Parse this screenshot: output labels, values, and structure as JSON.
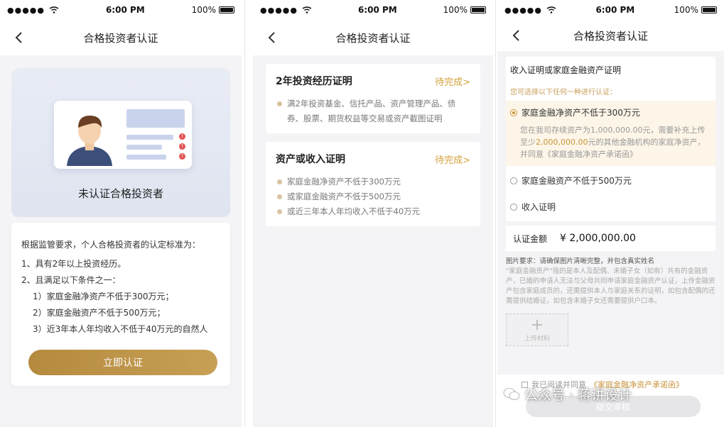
{
  "status_bar": {
    "signal": "●●●●●",
    "time": "6:00 PM",
    "battery": "100%"
  },
  "screen1": {
    "nav_title": "合格投资者认证",
    "hero_title": "未认证合格投资者",
    "rules": [
      "根据监管要求，个人合格投资者的认定标准为：",
      "1、具有2年以上投资经历。",
      "2、且满足以下条件之一：",
      "1）家庭金融净资产不低于300万元；",
      "2）家庭金融资产不低于500万元；",
      "3）近3年本人年均收入不低于40万元的自然人"
    ],
    "button": "立即认证"
  },
  "screen2": {
    "nav_title": "合格投资者认证",
    "cards": [
      {
        "title": "2年投资经历证明",
        "status": "待完成>",
        "items": [
          "满2年投资基金、信托产品、资产管理产品、债券、股票、期货权益等交易或资产截图证明"
        ]
      },
      {
        "title": "资产或收入证明",
        "status": "待完成>",
        "items": [
          "家庭金融净资产不低于300万元",
          "或家庭金融资产不低于500万元",
          "或近三年本人年均收入不低于40万元"
        ]
      }
    ]
  },
  "screen3": {
    "nav_title": "合格投资者认证",
    "section_title": "收入证明或家庭金融资产证明",
    "hint": "您可选择以下任何一种进行认证：",
    "options": [
      {
        "label": "家庭金融净资产不低于300万元",
        "selected": true
      },
      {
        "label": "家庭金融资产不低于500万元",
        "selected": false
      },
      {
        "label": "收入证明",
        "selected": false
      }
    ],
    "option_desc_a": "您在我司存续资产为1,000,000.00元，需要补充上传至少",
    "option_desc_hl": "2,000,000.00",
    "option_desc_b": "元的其他金融机构的家庭净资产，并同意《家庭金融净资产承诺函》",
    "amount_label": "认证金额",
    "amount_value": "¥ 2,000,000.00",
    "note_head": "图片要求：请确保图片清晰完整，并包含真实姓名",
    "note_body": "\"家庭金融资产\"指的是本人及配偶、未婚子女（如有）共有的金融资产，已婚的申请人无法与父母共同申请家庭金融资产认证，上传金融资产包含家庭成员的，还需提供本人与家庭关系的证明，如包含配偶的还需提供结婚证，如包含未婚子女还需要提供户口本。",
    "upload_label": "上传材料",
    "agree_text": "我已阅读并同意",
    "agree_link": "《家庭金融净资产承诺函》",
    "submit": "提交审核"
  },
  "watermark": "公众号 · 蒋讲设计"
}
